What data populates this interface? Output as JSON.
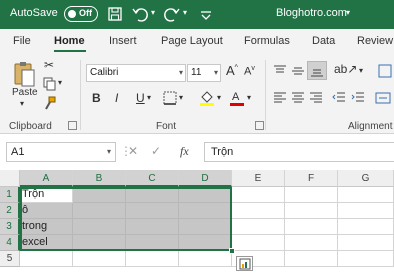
{
  "titlebar": {
    "autosave_label": "AutoSave",
    "autosave_state": "Off",
    "doc_title": "Bloghotro.com",
    "brand_color": "#217346"
  },
  "menu": {
    "tabs": [
      "File",
      "Home",
      "Insert",
      "Page Layout",
      "Formulas",
      "Data",
      "Review"
    ],
    "active": "Home"
  },
  "ribbon": {
    "clipboard": {
      "paste_label": "Paste",
      "group_label": "Clipboard"
    },
    "font": {
      "font_name": "Calibri",
      "font_size": "11",
      "grow_label": "A",
      "shrink_label": "A",
      "bold": "B",
      "italic": "I",
      "underline": "U",
      "group_label": "Font",
      "highlight_color": "#ffff00",
      "font_color": "#e00000"
    },
    "alignment": {
      "group_label": "Alignment"
    }
  },
  "formula_bar": {
    "name_box": "A1",
    "cancel": "✕",
    "enter": "✓",
    "fx": "fx",
    "content": "Trộn"
  },
  "sheet": {
    "columns": [
      "A",
      "B",
      "C",
      "D",
      "E",
      "F",
      "G"
    ],
    "rows": [
      "1",
      "2",
      "3",
      "4",
      "5"
    ],
    "cells_col_a": [
      "Trộn",
      "ô",
      "trong",
      "excel"
    ]
  }
}
